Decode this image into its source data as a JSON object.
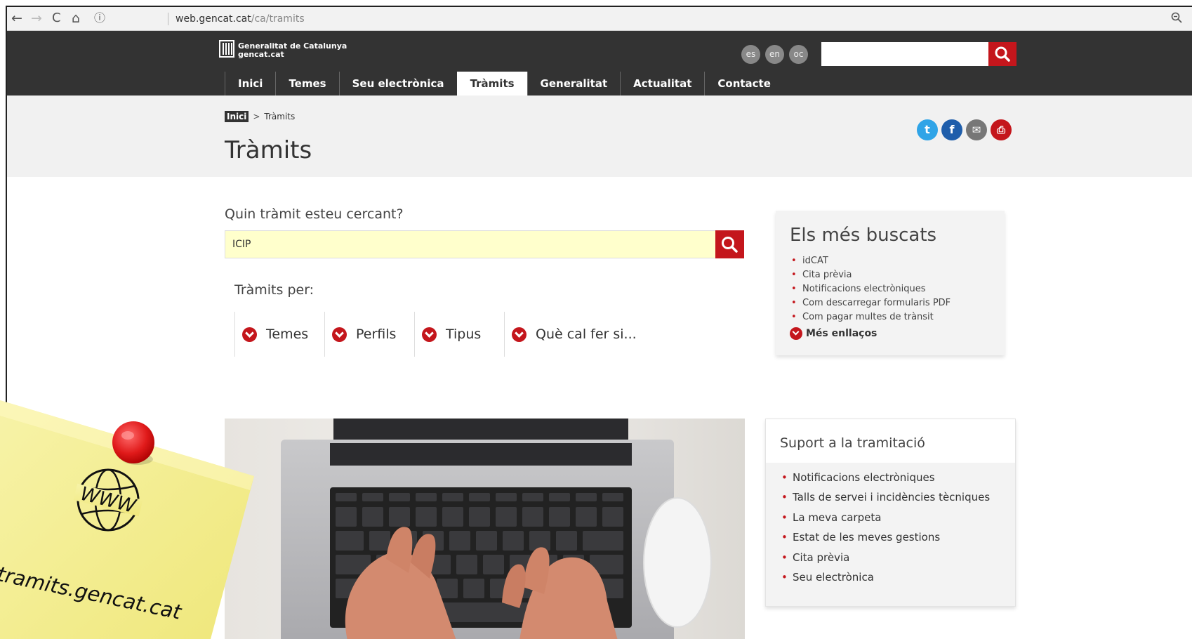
{
  "browser": {
    "url_host": "web.gencat.cat",
    "url_path": "/ca/tramits",
    "back_icon": "←",
    "forward_icon": "→",
    "reload_icon": "C",
    "home_icon": "⌂",
    "info_icon": "ⓘ",
    "zoom_icon": "🔍"
  },
  "header": {
    "logo_line1": "Generalitat de Catalunya",
    "logo_line2": "gencat.cat",
    "languages": [
      "es",
      "en",
      "oc"
    ],
    "search_placeholder": ""
  },
  "nav": {
    "items": [
      "Inici",
      "Temes",
      "Seu electrònica",
      "Tràmits",
      "Generalitat",
      "Actualitat",
      "Contacte"
    ],
    "active": "Tràmits"
  },
  "breadcrumb": {
    "home": "Inici",
    "separator": ">",
    "current": "Tràmits"
  },
  "page": {
    "title": "Tràmits"
  },
  "share": {
    "twitter": "t",
    "facebook": "f",
    "email": "✉",
    "print": "⎙"
  },
  "search": {
    "label": "Quin tràmit esteu cercant?",
    "value": "ICIP",
    "per_label": "Tràmits per:",
    "filters": [
      "Temes",
      "Perfils",
      "Tipus",
      "Què cal fer si..."
    ]
  },
  "popular": {
    "title": "Els més buscats",
    "items": [
      "idCAT",
      "Cita prèvia",
      "Notificacions electròniques",
      "Com descarregar formularis PDF",
      "Com pagar multes de trànsit"
    ],
    "more": "Més enllaços"
  },
  "support": {
    "title": "Suport a la tramitació",
    "items": [
      "Notificacions electròniques",
      "Talls de servei i incidències tècniques",
      "La meva carpeta",
      "Estat de les meves gestions",
      "Cita prèvia",
      "Seu electrònica"
    ]
  },
  "sticky": {
    "www": "WWW",
    "text": "tramits.gencat.cat"
  },
  "colors": {
    "header": "#333333",
    "accent_red": "#c4161c",
    "band": "#f1f1f1",
    "input_highlight": "#ffffcc"
  }
}
